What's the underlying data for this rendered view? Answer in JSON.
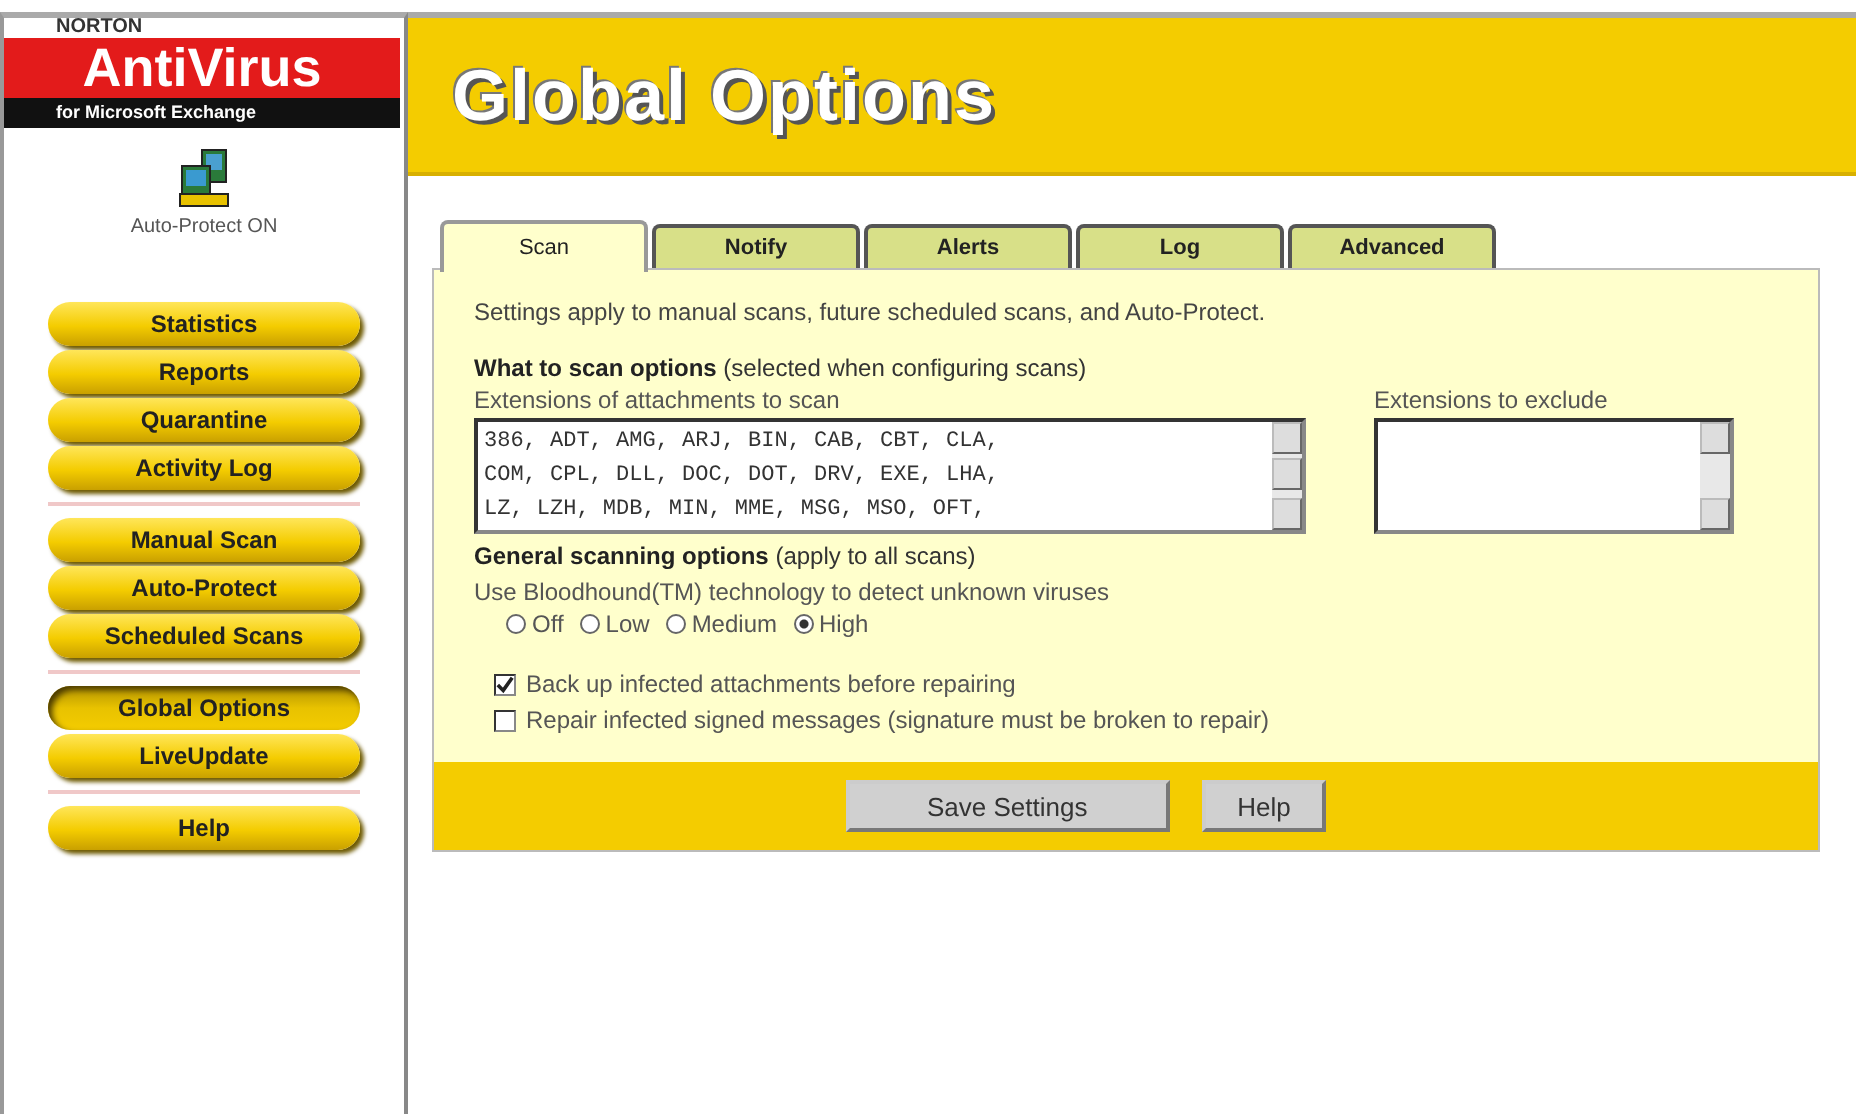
{
  "brand": {
    "maker": "NORTON",
    "product": "AntiVirus",
    "edition": "for Microsoft Exchange",
    "status": "Auto-Protect ON"
  },
  "sidebar": {
    "groups": [
      {
        "items": [
          {
            "label": "Statistics",
            "selected": false
          },
          {
            "label": "Reports",
            "selected": false
          },
          {
            "label": "Quarantine",
            "selected": false
          },
          {
            "label": "Activity Log",
            "selected": false
          }
        ]
      },
      {
        "items": [
          {
            "label": "Manual Scan",
            "selected": false
          },
          {
            "label": "Auto-Protect",
            "selected": false
          },
          {
            "label": "Scheduled Scans",
            "selected": false
          }
        ]
      },
      {
        "items": [
          {
            "label": "Global Options",
            "selected": true
          },
          {
            "label": "LiveUpdate",
            "selected": false
          }
        ]
      },
      {
        "items": [
          {
            "label": "Help",
            "selected": false
          }
        ]
      }
    ]
  },
  "page_title": "Global Options",
  "tabs": [
    {
      "label": "Scan",
      "selected": true
    },
    {
      "label": "Notify",
      "selected": false
    },
    {
      "label": "Alerts",
      "selected": false
    },
    {
      "label": "Log",
      "selected": false
    },
    {
      "label": "Advanced",
      "selected": false
    }
  ],
  "intro": "Settings apply to manual scans, future scheduled scans, and Auto-Protect.",
  "what_to_scan": {
    "heading": "**What to scan options** (selected when configuring scans)",
    "include_label": "Extensions of attachments to scan",
    "include_lines": [
      "386, ADT, AMG, ARJ, BIN, CAB, CBT, CLA,",
      "COM, CPL, DLL, DOC, DOT, DRV, EXE, LHA,",
      "LZ, LZH, MDB, MIN, MME, MSG, MSO, OFT,"
    ],
    "exclude_label": "Extensions to exclude"
  },
  "general": {
    "heading": "**General scanning options** (apply to all scans)",
    "bloodhound_label": "Use Bloodhound(TM) technology to detect unknown viruses",
    "levels": [
      {
        "label": "Off",
        "selected": false
      },
      {
        "label": "Low",
        "selected": false
      },
      {
        "label": "Medium",
        "selected": false
      },
      {
        "label": "High",
        "selected": true
      }
    ],
    "checkboxes": [
      {
        "label": "Back up infected attachments before repairing",
        "checked": true
      },
      {
        "label": "Repair infected signed messages (signature must be broken to repair)",
        "checked": false
      }
    ]
  },
  "buttons": [
    "Save Settings",
    "Help"
  ]
}
